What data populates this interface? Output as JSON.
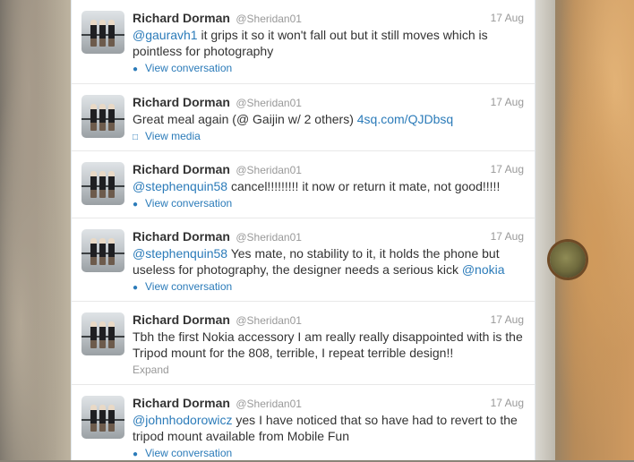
{
  "tweets": [
    {
      "name": "Richard Dorman",
      "handle": "@Sheridan01",
      "time": "17 Aug",
      "mention": "@gauravh1",
      "body": " it grips it so it won't fall out but it still moves which is pointless for photography",
      "action": "View conversation",
      "action_icon": "speech-bubble-icon"
    },
    {
      "name": "Richard Dorman",
      "handle": "@Sheridan01",
      "time": "17 Aug",
      "body": "Great meal again (@ Gaijin w/ 2 others) ",
      "link": "4sq.com/QJDbsq",
      "action": "View media",
      "action_icon": "document-icon"
    },
    {
      "name": "Richard Dorman",
      "handle": "@Sheridan01",
      "time": "17 Aug",
      "mention": "@stephenquin58",
      "body": " cancel!!!!!!!!! it now or return it mate, not good!!!!!",
      "action": "View conversation",
      "action_icon": "speech-bubble-icon"
    },
    {
      "name": "Richard Dorman",
      "handle": "@Sheridan01",
      "time": "17 Aug",
      "mention": "@stephenquin58",
      "body": " Yes mate, no stability to it, it holds the phone but useless for photography, the designer needs a serious kick ",
      "trailing_mention": "@nokia",
      "action": "View conversation",
      "action_icon": "speech-bubble-icon"
    },
    {
      "name": "Richard Dorman",
      "handle": "@Sheridan01",
      "time": "17 Aug",
      "body": "Tbh the first Nokia accessory I am really really disappointed with is the Tripod mount for the 808, terrible, I repeat terrible design!!",
      "action": "Expand"
    },
    {
      "name": "Richard Dorman",
      "handle": "@Sheridan01",
      "time": "17 Aug",
      "mention": "@johnhodorowicz",
      "body": " yes I have noticed that so have had to revert to the tripod mount available from Mobile Fun",
      "action": "View conversation",
      "action_icon": "speech-bubble-icon"
    }
  ],
  "colors": {
    "link": "#2b7bb9",
    "name": "#333333",
    "muted": "#999999"
  }
}
